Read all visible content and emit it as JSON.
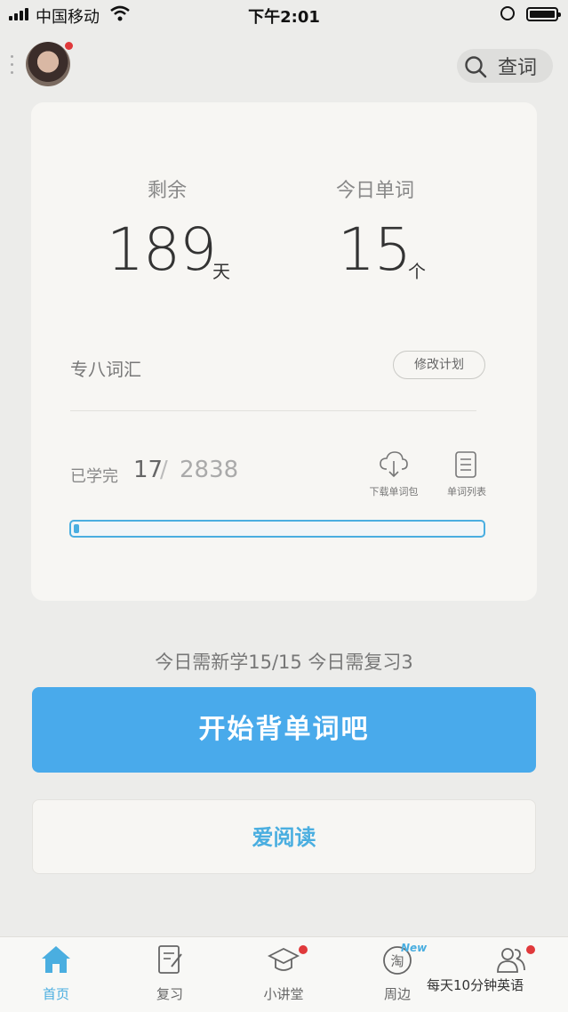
{
  "status_bar": {
    "carrier": "中国移动",
    "time": "下午2:01"
  },
  "header": {
    "search_label": "查词"
  },
  "card": {
    "remaining_label": "剩余",
    "remaining_value": "189",
    "remaining_unit": "天",
    "today_words_label": "今日单词",
    "today_words_value": "15",
    "today_words_unit": "个",
    "vocab_name": "专八词汇",
    "modify_plan_label": "修改计划",
    "learned_label": "已学完",
    "learned_count": "17",
    "learned_separator": "/",
    "learned_total": "2838",
    "download_label": "下载单词包",
    "wordlist_label": "单词列表",
    "progress_fraction": 0.006
  },
  "today_summary": "今日需新学15/15   今日需复习3",
  "start_button": "开始背单词吧",
  "read_button": "爱阅读",
  "tabs": [
    {
      "label": "首页",
      "icon": "home-icon",
      "active": true
    },
    {
      "label": "复习",
      "icon": "review-icon"
    },
    {
      "label": "小讲堂",
      "icon": "graduation-cap-icon",
      "badge": true
    },
    {
      "label": "周边",
      "icon": "taobao-icon",
      "new_label": "New"
    },
    {
      "label": "",
      "icon": "users-icon",
      "badge": true
    }
  ],
  "watermark": "每天10分钟英语",
  "colors": {
    "accent": "#49aaeb",
    "badge": "#e0393b",
    "background": "#ececea"
  }
}
